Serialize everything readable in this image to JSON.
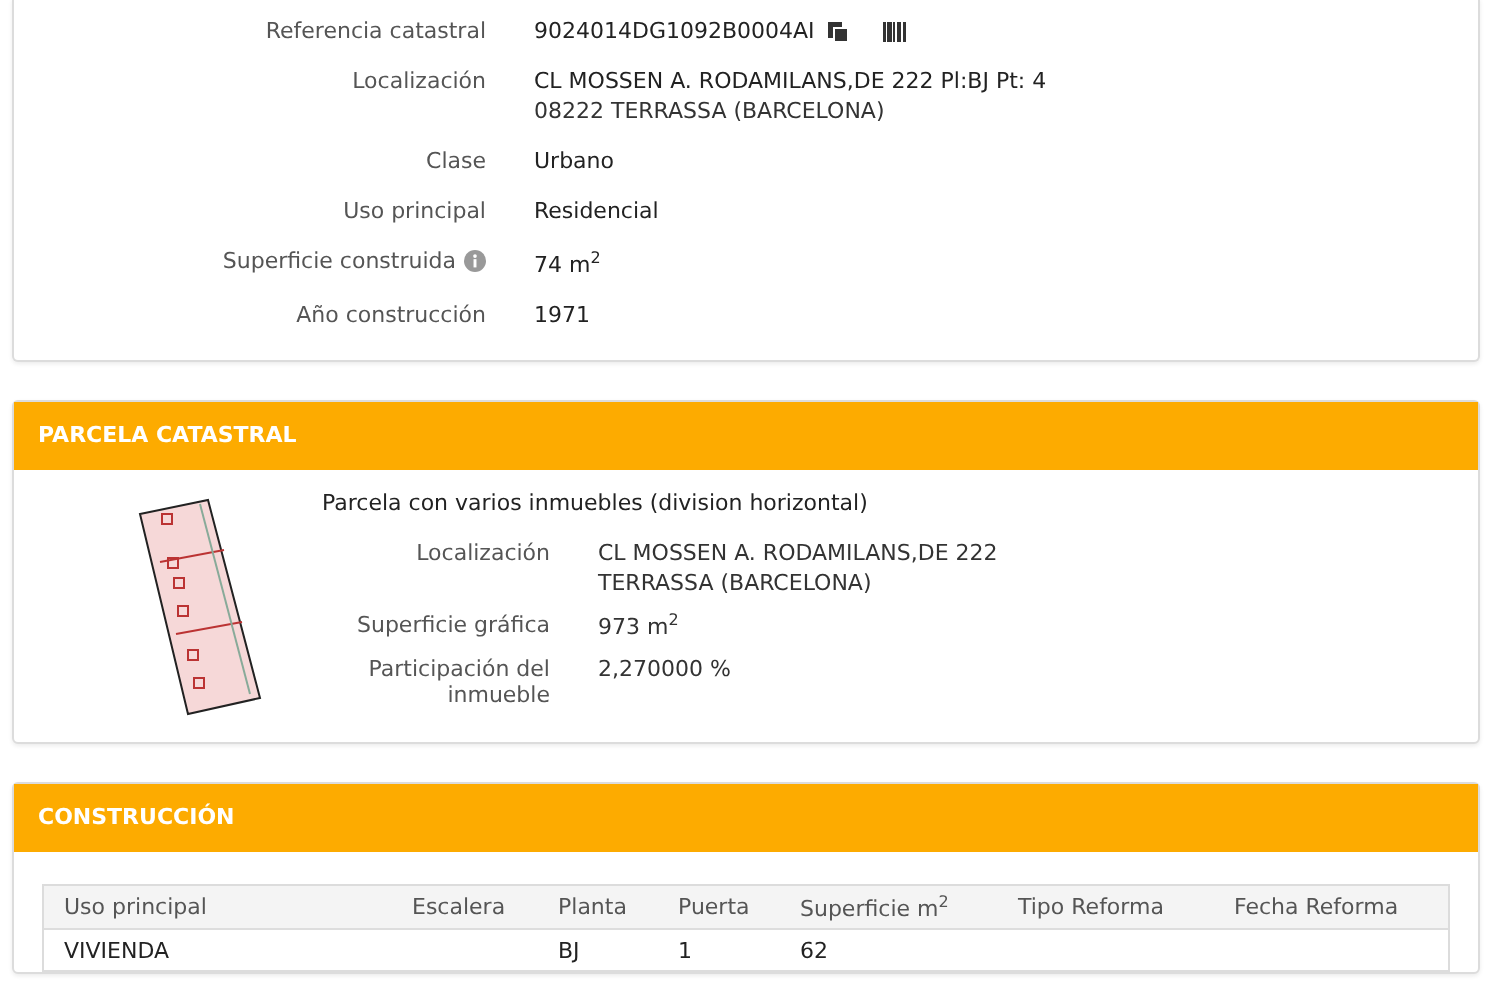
{
  "summary": {
    "rows": [
      {
        "label": "Referencia catastral",
        "value": "9024014DG1092B0004AI",
        "kind": "reference"
      },
      {
        "label": "Localización",
        "value": "CL MOSSEN A. RODAMILANS,DE 222 Pl:BJ Pt: 4",
        "value2": "08222 TERRASSA (BARCELONA)",
        "kind": "text"
      },
      {
        "label": "Clase",
        "value": "Urbano",
        "kind": "text"
      },
      {
        "label": "Uso principal",
        "value": "Residencial",
        "kind": "text"
      },
      {
        "label": "Superficie construida",
        "value": "74 m$^{2}$",
        "kind": "info"
      },
      {
        "label": "Año construcción",
        "value": "1971",
        "kind": "text"
      }
    ]
  },
  "parcel": {
    "title": "PARCELA CATASTRAL",
    "description": "Parcela con varios inmuebles (division horizontal)",
    "rows": [
      {
        "label": "Localización",
        "value": "CL MOSSEN A. RODAMILANS,DE 222",
        "value2": "TERRASSA (BARCELONA)"
      },
      {
        "label": "Superficie gráfica",
        "value": "973 m$^{2}$"
      },
      {
        "label": "Participación del inmueble",
        "value": "2,270000 %"
      }
    ]
  },
  "construction": {
    "title": "CONSTRUCCIÓN",
    "table": {
      "columns": [
        "Uso principal",
        "Escalera",
        "Planta",
        "Puerta",
        "Superficie m$^{2}$",
        "Tipo Reforma",
        "Fecha Reforma"
      ],
      "rows": [
        [
          "VIVIENDA",
          "",
          "BJ",
          "1",
          "62",
          "",
          ""
        ]
      ]
    }
  }
}
